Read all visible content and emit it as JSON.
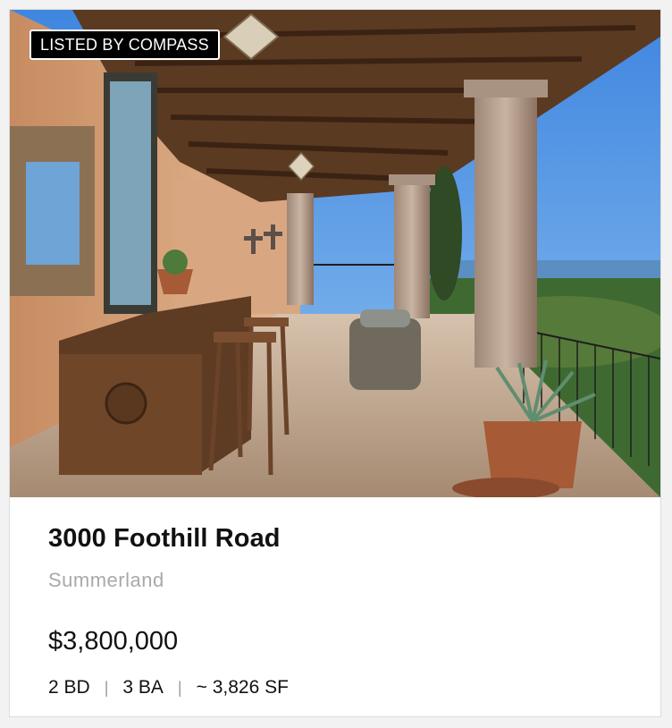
{
  "listing": {
    "badge": "LISTED BY COMPASS",
    "address": "3000 Foothill Road",
    "city": "Summerland",
    "price": "$3,800,000",
    "beds": "2 BD",
    "baths": "3 BA",
    "sqft": "~ 3,826 SF",
    "separator": "|"
  },
  "colors": {
    "badge_bg": "#000000",
    "badge_text": "#ffffff",
    "city_text": "#a9a9a9",
    "body_text": "#111111"
  }
}
